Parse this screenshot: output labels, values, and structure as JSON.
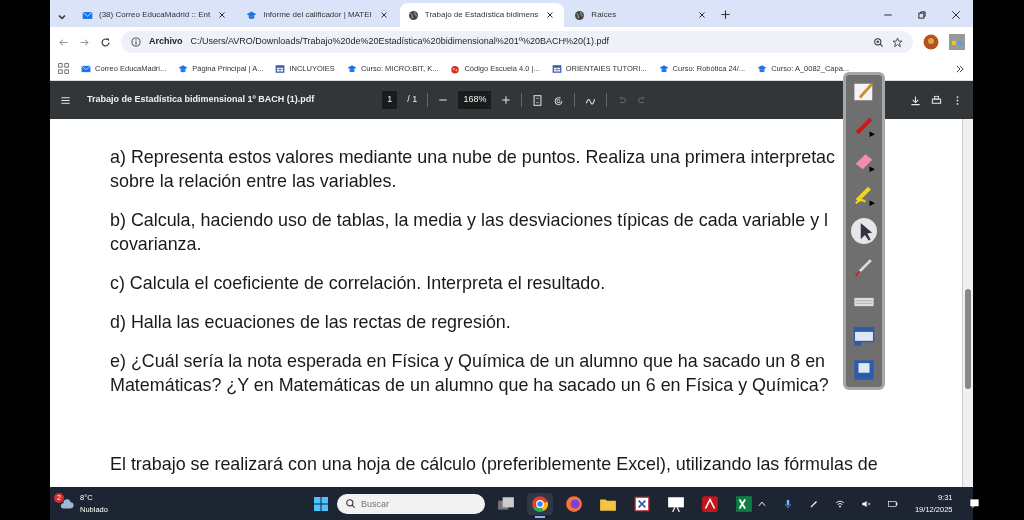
{
  "tabs": [
    {
      "title": "(38) Correo EducaMadrid :: Ent",
      "kind": "mail",
      "selected": false
    },
    {
      "title": "Informe del calificador | MATEI",
      "kind": "school",
      "selected": false
    },
    {
      "title": "Trabajo de Estadística bidimens",
      "kind": "globe",
      "selected": true
    },
    {
      "title": "Raíces",
      "kind": "globe",
      "selected": false
    }
  ],
  "address": {
    "label": "Archivo",
    "url": "C:/Users/AVRO/Downloads/Trabajo%20de%20Estadística%20bidimensional%201º%20BACH%20(1).pdf"
  },
  "bookmarks": [
    {
      "title": "Correo EducaMadri...",
      "kind": "mail"
    },
    {
      "title": "Página Principal | A...",
      "kind": "school"
    },
    {
      "title": "INCLUYOIES",
      "kind": "calendar"
    },
    {
      "title": "Curso: MICRO:BIT, K...",
      "kind": "school"
    },
    {
      "title": "Código Escuela 4.0 |...",
      "kind": "code"
    },
    {
      "title": "ORIENTAIES TUTORI...",
      "kind": "calendar"
    },
    {
      "title": "Curso: Robótica 24/...",
      "kind": "school"
    },
    {
      "title": "Curso: A_0082_Capa...",
      "kind": "school"
    }
  ],
  "pdf_toolbar": {
    "title": "Trabajo de Estadística bidimensional 1º BACH (1).pdf",
    "page": "1",
    "page_total": "/ 1",
    "zoom": "168%"
  },
  "document": {
    "paragraphs": [
      {
        "lines": [
          "a) Representa estos valores mediante una nube de puntos. Realiza una primera interpretac",
          "sobre la relación entre las variables."
        ]
      },
      {
        "lines": [
          "b) Calcula, haciendo uso de tablas, la media y las desviaciones típicas de cada variable y l",
          "covarianza."
        ]
      },
      {
        "lines": [
          "c) Calcula el coeficiente de correlación. Interpreta el resultado."
        ]
      },
      {
        "lines": [
          "d) Halla las ecuaciones de las rectas de regresión."
        ]
      },
      {
        "lines": [
          "e) ¿Cuál sería la nota esperada en Física y Química de un alumno que ha sacado un 8 en",
          "Matemáticas? ¿Y en Matemáticas de un alumno que ha sacado un 6 en Física y Química?"
        ]
      },
      {
        "lines": [
          "El trabajo se realizará con una hoja de cálculo (preferiblemente Excel), utilizando las fórmulas de"
        ]
      }
    ]
  },
  "annotation_tools": [
    {
      "kind": "pen-paper",
      "selected": false
    },
    {
      "kind": "pen",
      "selected": false
    },
    {
      "kind": "eraser",
      "selected": false
    },
    {
      "kind": "highlighter",
      "selected": false
    },
    {
      "kind": "pointer",
      "selected": true
    },
    {
      "kind": "brush",
      "selected": false
    },
    {
      "kind": "keyboard",
      "selected": false
    },
    {
      "kind": "capture",
      "selected": false
    },
    {
      "kind": "display",
      "selected": false
    }
  ],
  "taskbar": {
    "weather_badge": "2",
    "temperature": "8°C",
    "condition": "Nublado",
    "search_placeholder": "Buscar",
    "apps": [
      {
        "kind": "taskview",
        "active": false
      },
      {
        "kind": "chrome",
        "active": true
      },
      {
        "kind": "firefox",
        "active": false
      },
      {
        "kind": "folder",
        "active": false
      },
      {
        "kind": "snip",
        "active": false
      },
      {
        "kind": "board",
        "active": false
      },
      {
        "kind": "acrobat",
        "active": false
      },
      {
        "kind": "excel",
        "active": false
      }
    ],
    "time": "9:31",
    "date": "19/12/2025"
  }
}
